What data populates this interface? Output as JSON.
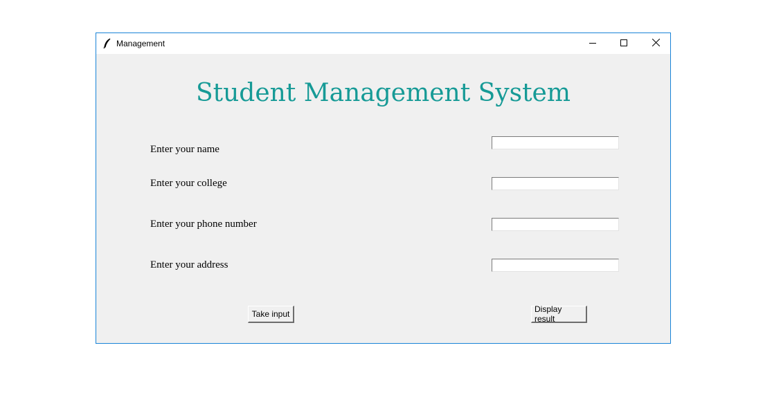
{
  "window": {
    "title": "Management",
    "icons": {
      "app": "feather-icon",
      "minimize": "minimize-icon",
      "maximize": "maximize-icon",
      "close": "close-icon"
    }
  },
  "main": {
    "heading": "Student Management System",
    "heading_color": "#169a96",
    "fields": [
      {
        "label": "Enter your name",
        "value": ""
      },
      {
        "label": "Enter your college",
        "value": ""
      },
      {
        "label": "Enter your phone number",
        "value": ""
      },
      {
        "label": "Enter your address",
        "value": ""
      }
    ],
    "buttons": {
      "take_input": "Take input",
      "display_result": "Display result"
    }
  }
}
